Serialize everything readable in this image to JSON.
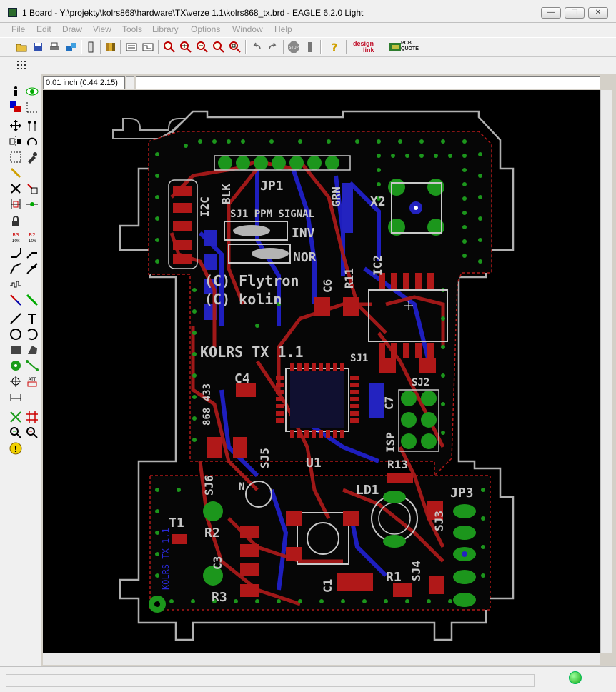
{
  "window": {
    "title": "1 Board - Y:\\projekty\\kolrs868\\hardware\\TX\\verze 1.1\\kolrs868_tx.brd - EAGLE 6.2.0 Light",
    "controls": [
      "minimize",
      "restore",
      "close"
    ]
  },
  "menu": [
    "File",
    "Edit",
    "Draw",
    "View",
    "Tools",
    "Library",
    "Options",
    "Window",
    "Help"
  ],
  "toolbar": {
    "icons": [
      "open-icon",
      "save-icon",
      "print-icon",
      "cam-icon",
      "script-icon",
      "library-icon",
      "schematic-icon",
      "board-icon",
      "zoom-fit-icon",
      "zoom-in-icon",
      "zoom-out-icon",
      "zoom-redraw-icon",
      "zoom-select-icon",
      "undo-icon",
      "redo-icon",
      "stop-icon",
      "go-icon",
      "help-icon"
    ],
    "logo_design": "design",
    "logo_link": "link",
    "logo_pcb": "PCB",
    "logo_quote": "QUOTE"
  },
  "coord": {
    "readout": "0.01 inch (0.44 2.15)",
    "command": ""
  },
  "board": {
    "texts": {
      "jp1": "JP1",
      "x2": "X2",
      "i2c": "I2C",
      "blk": "BLK",
      "grn": "GRN",
      "sj1_sig": "SJ1 PPM SIGNAL",
      "inv": "INV",
      "nor": "NOR",
      "copy1": "(C) Flytron",
      "copy2": "(C) kolin",
      "ic2": "IC2",
      "c6": "C6",
      "r11": "R11",
      "title": "KOLRS TX 1.1",
      "sj1": "SJ1",
      "sj2": "SJ2",
      "c4": "C4",
      "rfm": "868 433",
      "c7": "C7",
      "isp": "ISP",
      "sj5": "SJ5",
      "sj6": "SJ6",
      "u1": "U1",
      "r13": "R13",
      "ld1": "LD1",
      "jp3": "JP3",
      "t1": "T1",
      "r2": "R2",
      "r3": "R3",
      "c3": "C3",
      "c1": "C1",
      "r1": "R1",
      "sj3": "SJ3",
      "sj4": "SJ4",
      "kolrs_small": "KOLRS TX 1.1",
      "n": "N"
    }
  },
  "colors": {
    "copper_top": "#b22222",
    "copper_bottom": "#2a2ad8",
    "pads": "#2e9e2e",
    "silk": "#c8c8c8",
    "outline": "#a0a0a0",
    "canvas": "#000000"
  },
  "status": {
    "text": ""
  }
}
